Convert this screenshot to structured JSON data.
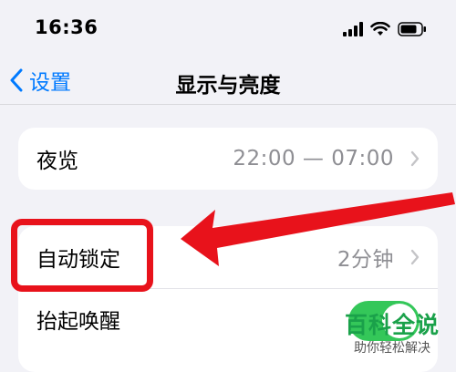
{
  "status_bar": {
    "time": "16:36"
  },
  "nav": {
    "back_label": "设置",
    "title": "显示与亮度"
  },
  "night_shift": {
    "label": "夜览",
    "value": "22:00 — 07:00"
  },
  "auto_lock": {
    "label": "自动锁定",
    "value": "2分钟"
  },
  "raise_to_wake": {
    "label": "抬起唤醒",
    "enabled": true
  },
  "watermark": {
    "title": "百科全说",
    "subtitle": "助你轻松解决"
  },
  "colors": {
    "accent": "#007aff",
    "toggle_on": "#34c759",
    "annotation": "#e8121b",
    "watermark": "#1aa14a"
  },
  "icons": [
    "signal-icon",
    "wifi-icon",
    "battery-icon",
    "back-chevron-icon",
    "chevron-right-icon"
  ]
}
